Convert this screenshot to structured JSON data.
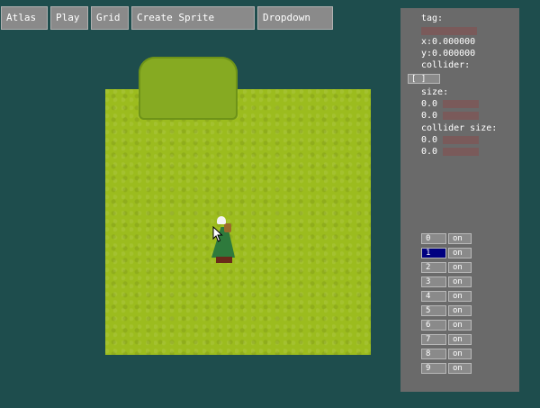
{
  "toolbar": {
    "atlas": "Atlas",
    "play": "Play",
    "grid": "Grid",
    "create_sprite": "Create Sprite",
    "dropdown": "Dropdown"
  },
  "inspector": {
    "tag_label": "tag:",
    "x_label": "x:0.000000",
    "y_label": "y:0.000000",
    "collider_label": "collider:",
    "collider_toggle": "[ ]",
    "size_label": "size:",
    "size_w": "0.0",
    "size_h": "0.0",
    "collider_size_label": "collider size:",
    "collider_size_w": "0.0",
    "collider_size_h": "0.0"
  },
  "layers": [
    {
      "index": "0",
      "state": "on",
      "active": false
    },
    {
      "index": "1",
      "state": "on",
      "active": true
    },
    {
      "index": "2",
      "state": "on",
      "active": false
    },
    {
      "index": "3",
      "state": "on",
      "active": false
    },
    {
      "index": "4",
      "state": "on",
      "active": false
    },
    {
      "index": "5",
      "state": "on",
      "active": false
    },
    {
      "index": "6",
      "state": "on",
      "active": false
    },
    {
      "index": "7",
      "state": "on",
      "active": false
    },
    {
      "index": "8",
      "state": "on",
      "active": false
    },
    {
      "index": "9",
      "state": "on",
      "active": false
    }
  ],
  "colors": {
    "background": "#1e4d4d",
    "grass": "#9cbc1e",
    "panel": "#6a6a6a",
    "active_layer": "#000080"
  }
}
